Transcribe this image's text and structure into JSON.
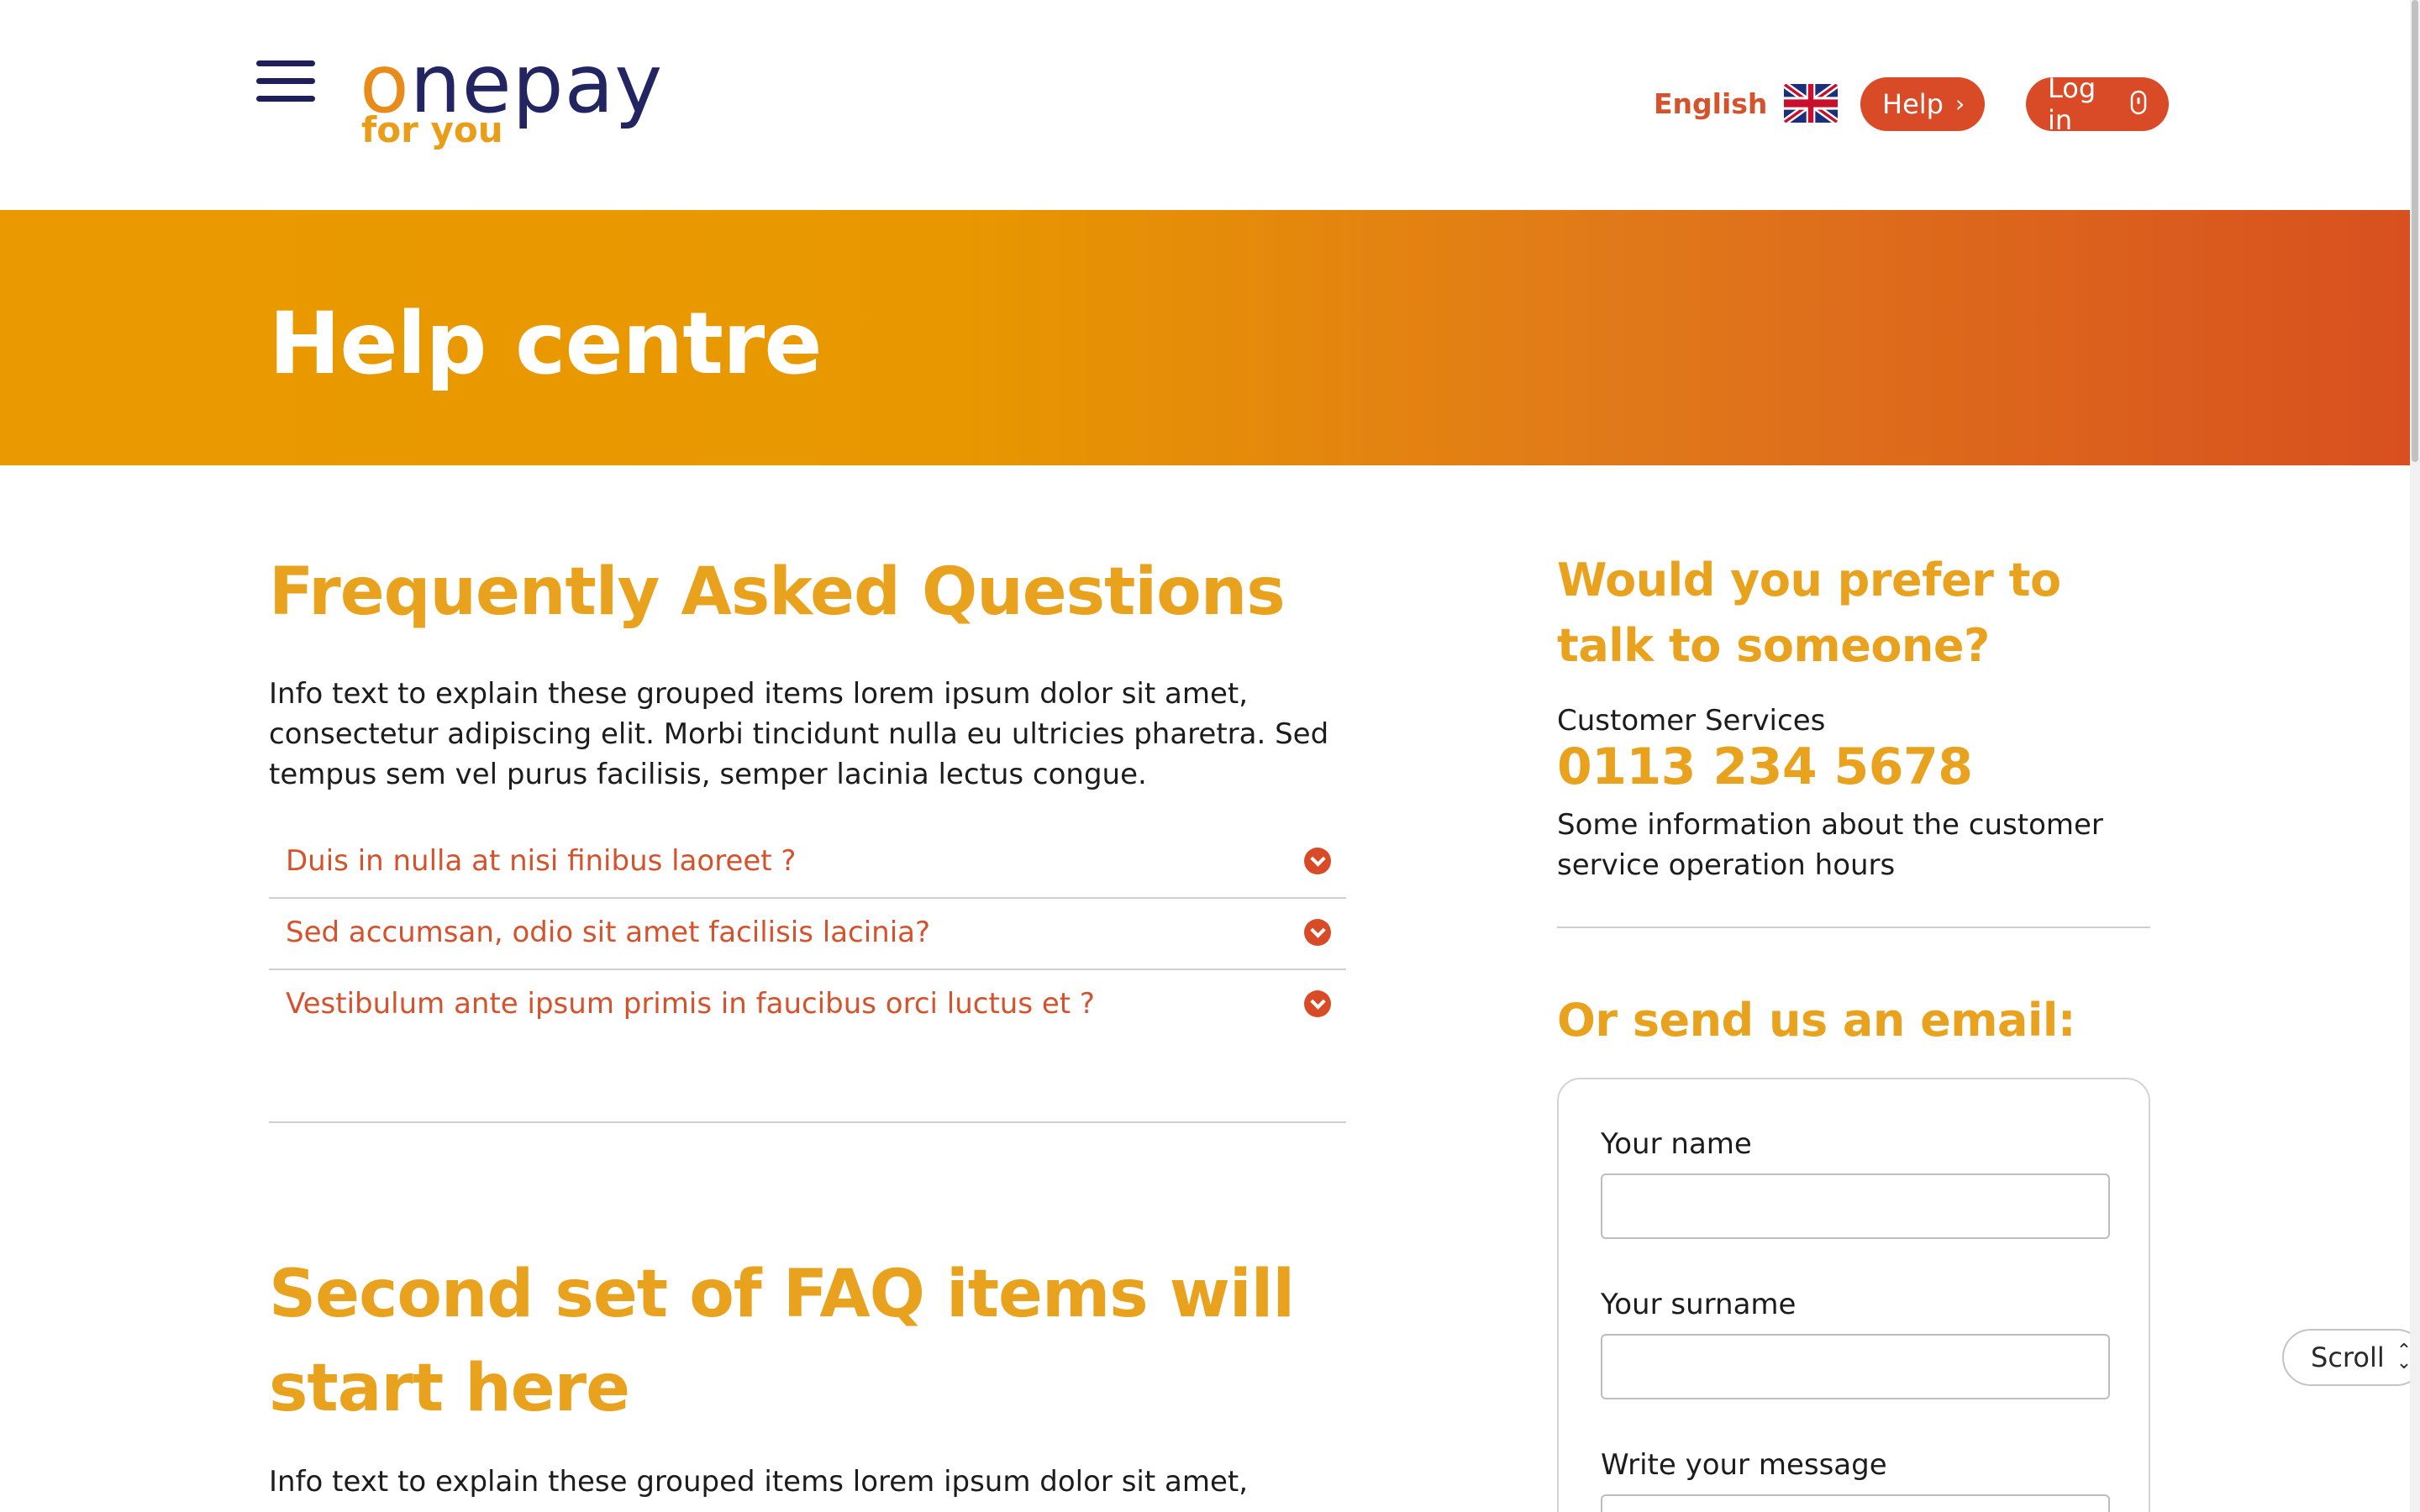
{
  "header": {
    "logo": {
      "word_first": "o",
      "word_rest": "nepay",
      "tagline": "for you"
    },
    "language": {
      "label": "English",
      "flag_icon": "uk-flag-icon"
    },
    "help_button": {
      "label": "Help",
      "icon": "chevron-right-icon"
    },
    "login_button": {
      "label": "Log in",
      "icon": "lock-icon"
    }
  },
  "banner": {
    "title": "Help centre"
  },
  "faq": {
    "title": "Frequently Asked Questions",
    "info": "Info text to explain these grouped items lorem ipsum dolor sit amet, consectetur adipiscing elit. Morbi tincidunt nulla eu ultricies pharetra. Sed tempus sem vel purus facilisis, semper lacinia lectus congue.",
    "items": [
      {
        "question": "Duis in nulla at nisi finibus laoreet ?"
      },
      {
        "question": "Sed accumsan, odio sit amet facilisis lacinia?"
      },
      {
        "question": "Vestibulum ante ipsum primis in faucibus orci luctus et ?"
      }
    ]
  },
  "faq2": {
    "title": "Second set of FAQ items will start here",
    "info": "Info text to explain these grouped items lorem ipsum dolor sit amet,"
  },
  "contact": {
    "title": "Would you prefer to talk to someone?",
    "cs_label": "Customer Services",
    "phone": "0113 234 5678",
    "info": "Some information about the customer service operation hours"
  },
  "email_form": {
    "title": "Or send us an email:",
    "name_label": "Your name",
    "name_value": "",
    "surname_label": "Your surname",
    "surname_value": "",
    "message_label": "Write your message",
    "message_value": ""
  },
  "scroll_button": {
    "label": "Scroll"
  },
  "colors": {
    "brand_navy": "#232462",
    "brand_orange": "#e9a21d",
    "accent_red": "#d94b26",
    "banner_start": "#ea9a00",
    "banner_end": "#d8501f"
  }
}
